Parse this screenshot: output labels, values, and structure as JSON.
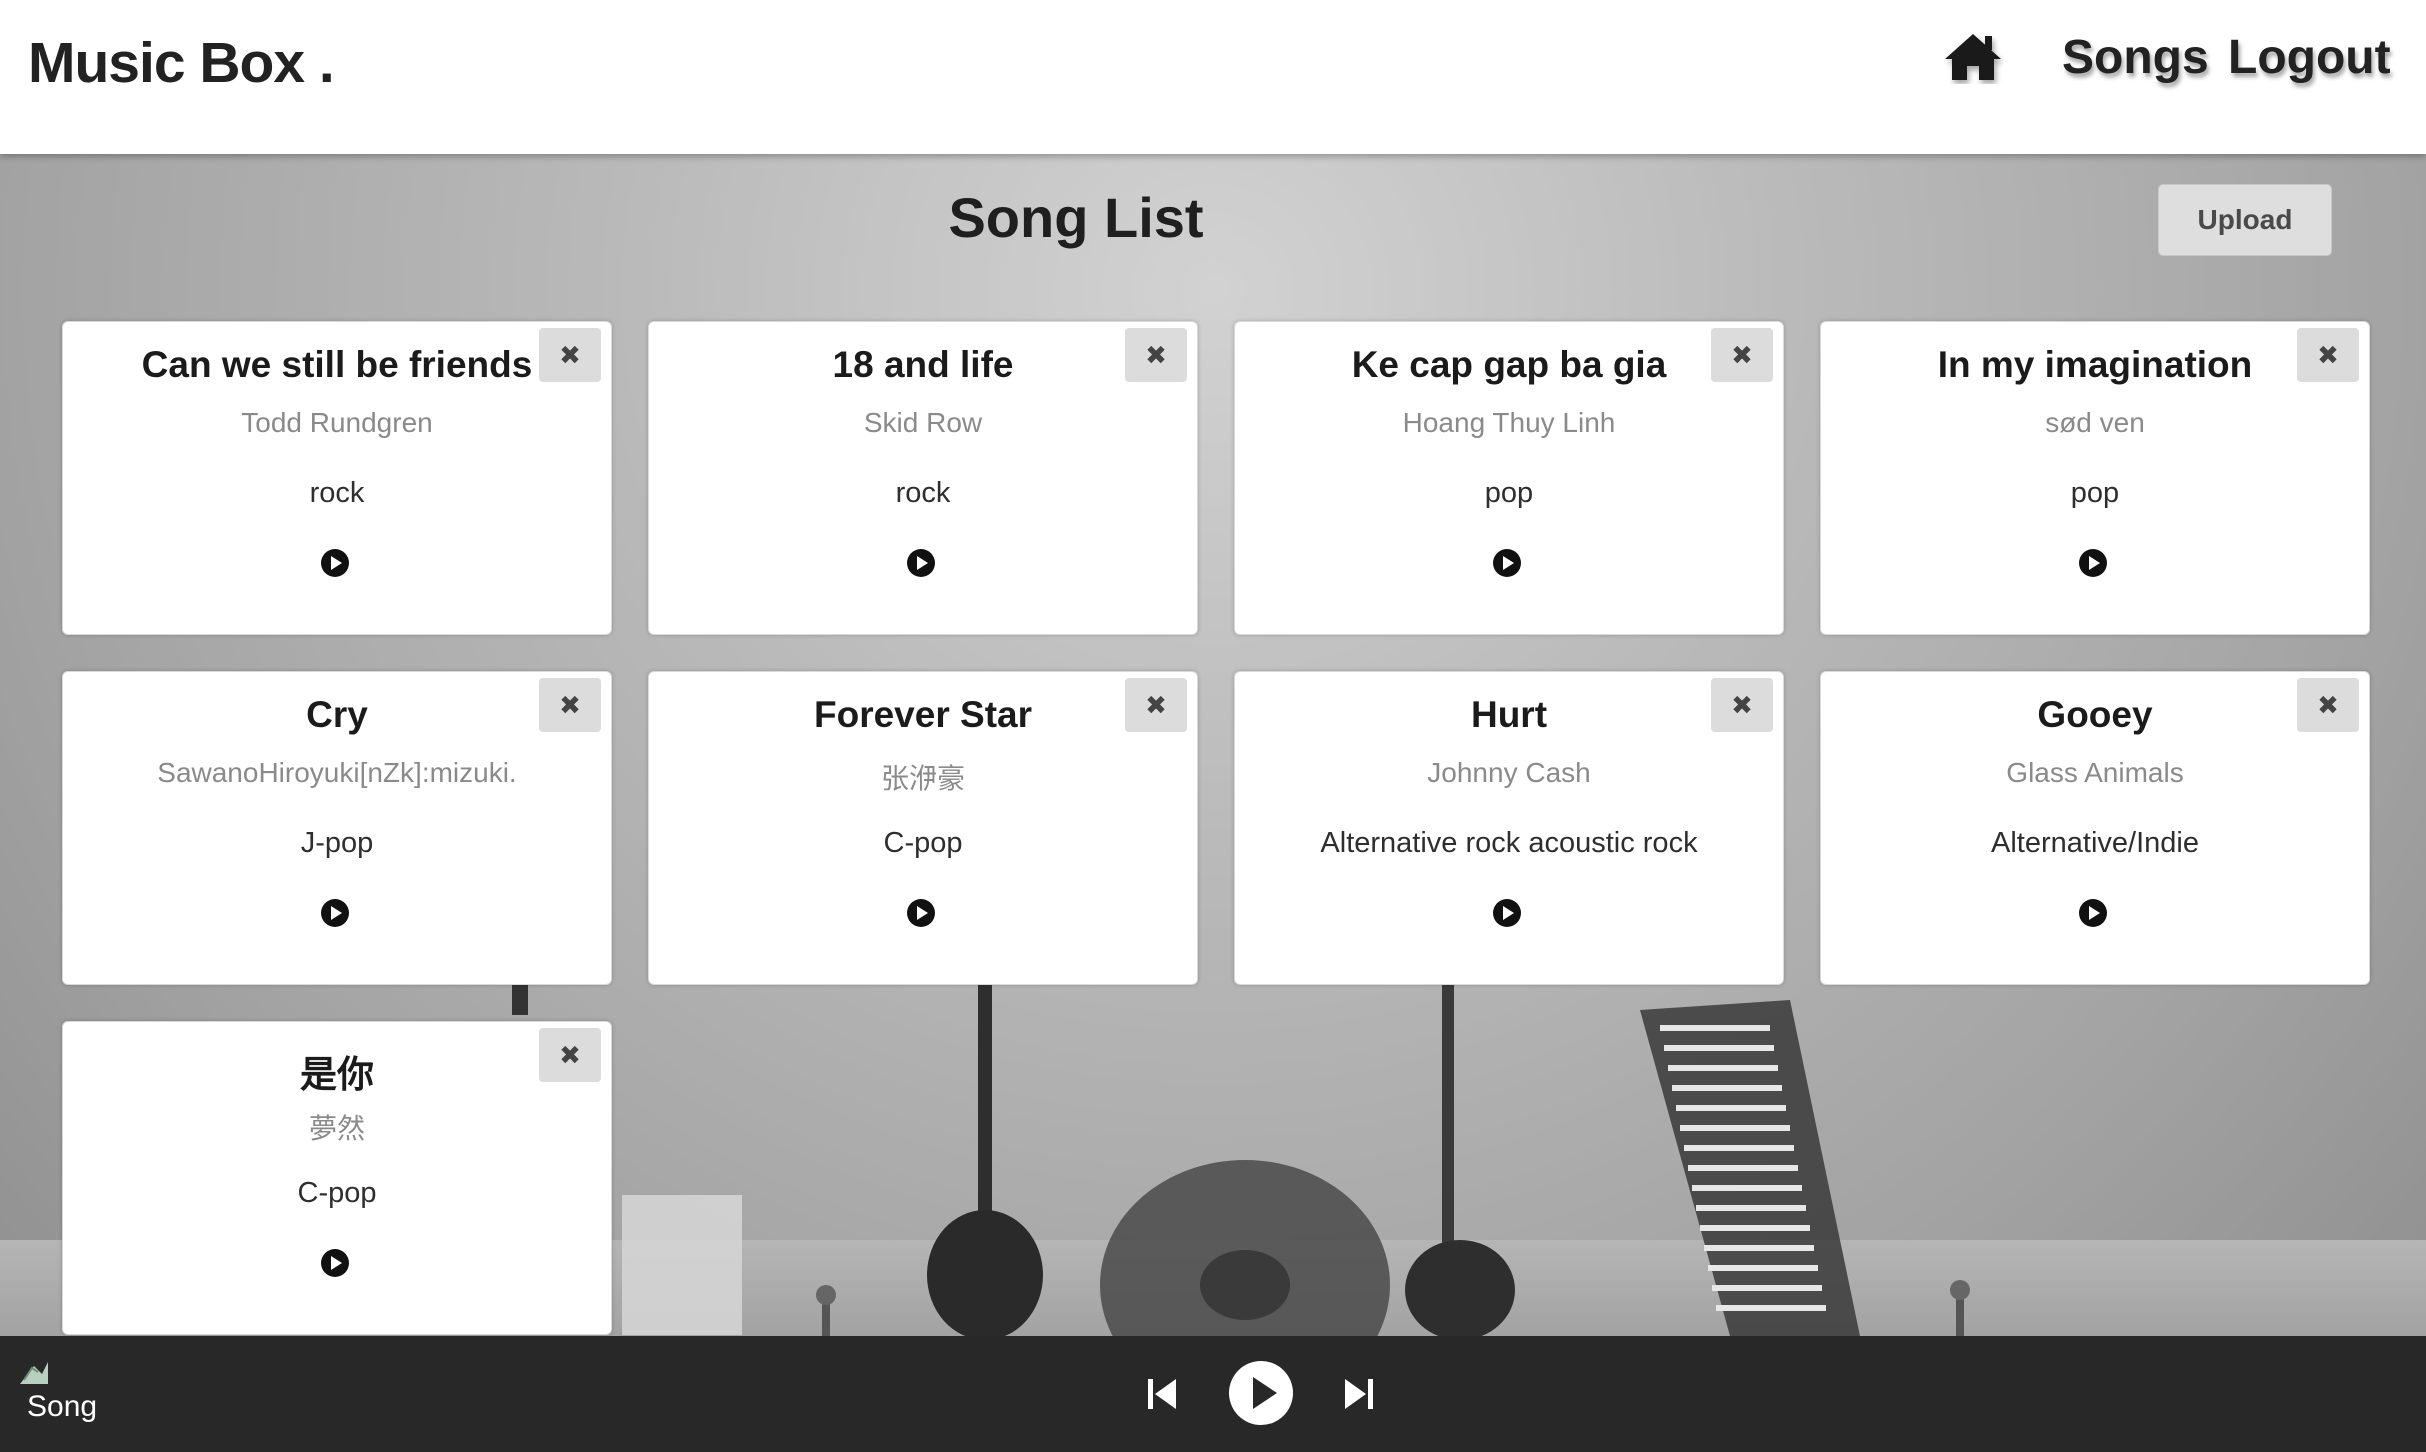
{
  "header": {
    "brand": "Music Box .",
    "nav": {
      "home_icon": "home-icon",
      "songs_label": "Songs",
      "logout_label": "Logout"
    }
  },
  "main": {
    "title": "Song List",
    "upload_label": "Upload"
  },
  "songs": [
    {
      "title": "Can we still be friends",
      "artist": "Todd Rundgren",
      "genre": "rock"
    },
    {
      "title": "18 and life",
      "artist": "Skid Row",
      "genre": "rock"
    },
    {
      "title": "Ke cap gap ba gia",
      "artist": "Hoang Thuy Linh",
      "genre": "pop"
    },
    {
      "title": "In my imagination",
      "artist": "sød ven",
      "genre": "pop"
    },
    {
      "title": "Cry",
      "artist": "SawanoHiroyuki[nZk]:mizuki.",
      "genre": "J-pop"
    },
    {
      "title": "Forever Star",
      "artist": "张洢豪",
      "genre": "C-pop"
    },
    {
      "title": "Hurt",
      "artist": "Johnny Cash",
      "genre": "Alternative rock acoustic rock"
    },
    {
      "title": "Gooey",
      "artist": "Glass Animals",
      "genre": "Alternative/Indie"
    },
    {
      "title": "是你",
      "artist": "夢然",
      "genre": "C-pop"
    }
  ],
  "card_actions": {
    "delete_glyph": "✖",
    "delete_icon": "close-icon",
    "play_icon": "play-circle-icon"
  },
  "player": {
    "label": "Song",
    "thumb_icon": "broken-image-icon",
    "prev_icon": "skip-previous-icon",
    "play_icon": "play-icon",
    "next_icon": "skip-next-icon"
  },
  "colors": {
    "header_bg": "#ffffff",
    "player_bg": "#282828",
    "card_bg": "#ffffff",
    "button_bg": "#dedede"
  }
}
